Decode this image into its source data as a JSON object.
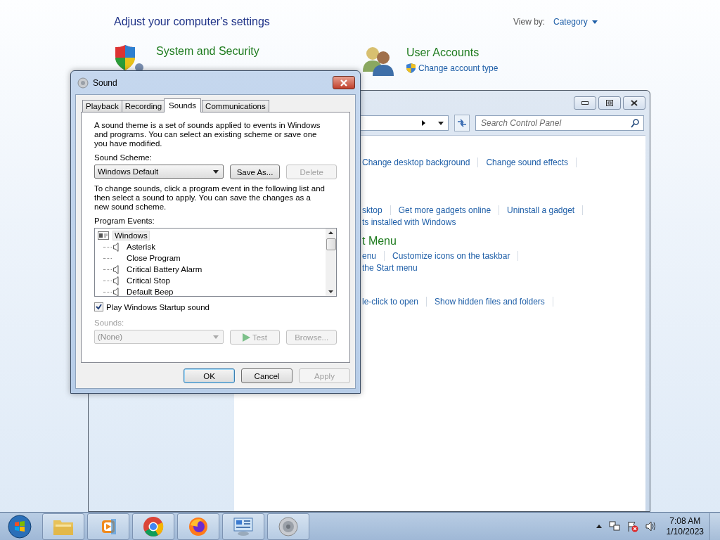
{
  "back_window": {
    "heading": "Adjust your computer's settings",
    "view_by": {
      "label": "View by:",
      "value": "Category"
    },
    "categories": [
      {
        "kind": "security",
        "title": "System and Security"
      },
      {
        "kind": "users",
        "title": "User Accounts",
        "links": [
          "Change account type"
        ]
      }
    ]
  },
  "front_window": {
    "search": {
      "placeholder": "Search Control Panel"
    },
    "sections": [
      {
        "rows": [
          {
            "links": [
              "Change desktop background",
              "Change sound effects"
            ],
            "divider": true
          }
        ]
      },
      {
        "rows": [
          {
            "links": [
              "sktop",
              "Get more gadgets online",
              "Uninstall a gadget"
            ],
            "divider": true
          },
          {
            "links": [
              "ts installed with Windows"
            ],
            "divider": false
          }
        ]
      },
      {
        "title": "t Menu",
        "rows": [
          {
            "links": [
              "enu",
              "Customize icons on the taskbar"
            ],
            "divider": true
          },
          {
            "links": [
              "the Start menu"
            ],
            "divider": false
          }
        ]
      },
      {
        "rows": [
          {
            "links": [
              "le-click to open",
              "Show hidden files and folders"
            ],
            "divider": true
          }
        ]
      }
    ]
  },
  "dialog": {
    "title": "Sound",
    "tabs": [
      {
        "label": "Playback",
        "selected": false
      },
      {
        "label": "Recording",
        "selected": false
      },
      {
        "label": "Sounds",
        "selected": true
      },
      {
        "label": "Communications",
        "selected": false
      }
    ],
    "intro": "A sound theme is a set of sounds applied to events in Windows and programs.  You can select an existing scheme or save one you have modified.",
    "scheme_label": "Sound Scheme:",
    "scheme_value": "Windows Default",
    "scheme_buttons": [
      {
        "label": "Save As...",
        "disabled": false
      },
      {
        "label": "Delete",
        "disabled": true
      }
    ],
    "instructions": "To change sounds, click a program event in the following list and then select a sound to apply.  You can save the changes as a new sound scheme.",
    "events_label": "Program Events:",
    "events": {
      "label": "Windows",
      "selected": true,
      "children": [
        {
          "label": "Asterisk",
          "has_sound": true,
          "selected": false
        },
        {
          "label": "Close Program",
          "has_sound": false,
          "selected": false
        },
        {
          "label": "Critical Battery Alarm",
          "has_sound": true,
          "selected": false
        },
        {
          "label": "Critical Stop",
          "has_sound": true,
          "selected": false
        },
        {
          "label": "Default Beep",
          "has_sound": true,
          "selected": false
        }
      ]
    },
    "startup": {
      "label": "Play Windows Startup sound",
      "checked": true
    },
    "sounds_label": "Sounds:",
    "sounds_value": "(None)",
    "sounds_disabled": true,
    "sound_buttons": [
      {
        "kind": "test",
        "label": "Test",
        "disabled": true
      },
      {
        "kind": "browse",
        "label": "Browse...",
        "disabled": true
      }
    ],
    "footer_buttons": [
      {
        "label": "OK",
        "disabled": false,
        "default": true
      },
      {
        "label": "Cancel",
        "disabled": false,
        "default": false
      },
      {
        "label": "Apply",
        "disabled": true,
        "default": false
      }
    ]
  },
  "taskbar": {
    "apps": [
      {
        "kind": "explorer"
      },
      {
        "kind": "media"
      },
      {
        "kind": "chrome"
      },
      {
        "kind": "firefox"
      },
      {
        "kind": "control"
      },
      {
        "kind": "sound"
      }
    ],
    "time": "7:08 AM",
    "date": "1/10/2023"
  }
}
